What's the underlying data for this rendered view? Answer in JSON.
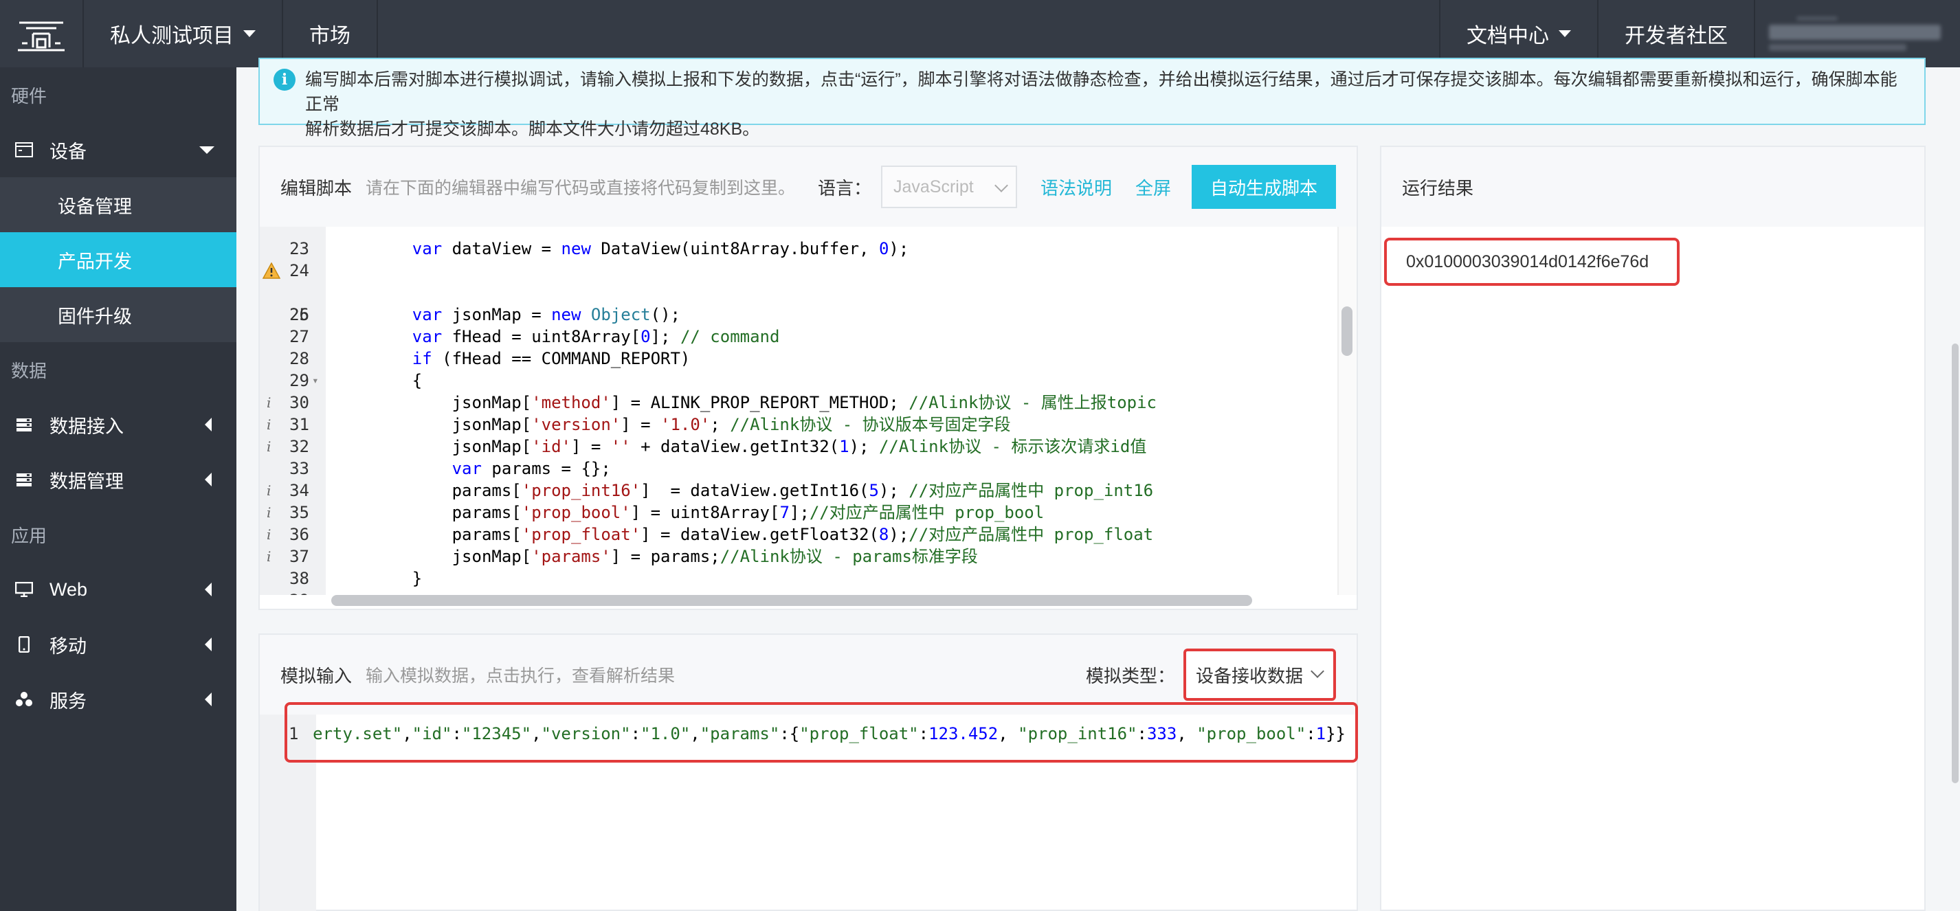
{
  "topbar": {
    "project_label": "私人测试项目",
    "market_label": "市场",
    "docs_label": "文档中心",
    "community_label": "开发者社区"
  },
  "sidebar": {
    "sections": {
      "hardware": "硬件",
      "data": "数据",
      "apps": "应用"
    },
    "device": "设备",
    "device_sub": [
      "设备管理",
      "产品开发",
      "固件升级"
    ],
    "data_access": "数据接入",
    "data_manage": "数据管理",
    "web": "Web",
    "mobile": "移动",
    "service": "服务"
  },
  "notice": {
    "text_1": "编写脚本后需对脚本进行模拟调试，请输入模拟上报和下发的数据，点击“运行”，脚本引擎将对语法做静态检查，并给出模拟运行结果，通过后才可保存提交该脚本。每次编辑都需要重新模拟和运行，确保脚本能正常",
    "text_2": "解析数据后才可提交该脚本。脚本文件大小请勿超过48KB。"
  },
  "editor": {
    "title": "编辑脚本",
    "hint": "请在下面的编辑器中编写代码或直接将代码复制到这里。",
    "language_label": "语言：",
    "language_value": "JavaScript",
    "syntax_link": "语法说明",
    "fullscreen_link": "全屏",
    "generate_button": "自动生成脚本"
  },
  "result": {
    "title": "运行结果",
    "value": "0x0100003039014d0142f6e76d"
  },
  "simulation": {
    "title": "模拟输入",
    "hint": "输入模拟数据，点击执行，查看解析结果",
    "type_label": "模拟类型：",
    "type_value": "设备接收数据",
    "line_number": "1"
  },
  "colors": {
    "accent": "#23c2e1",
    "highlight": "#e23b3b",
    "topbar": "#353b45",
    "sidebar": "#2f343d"
  }
}
